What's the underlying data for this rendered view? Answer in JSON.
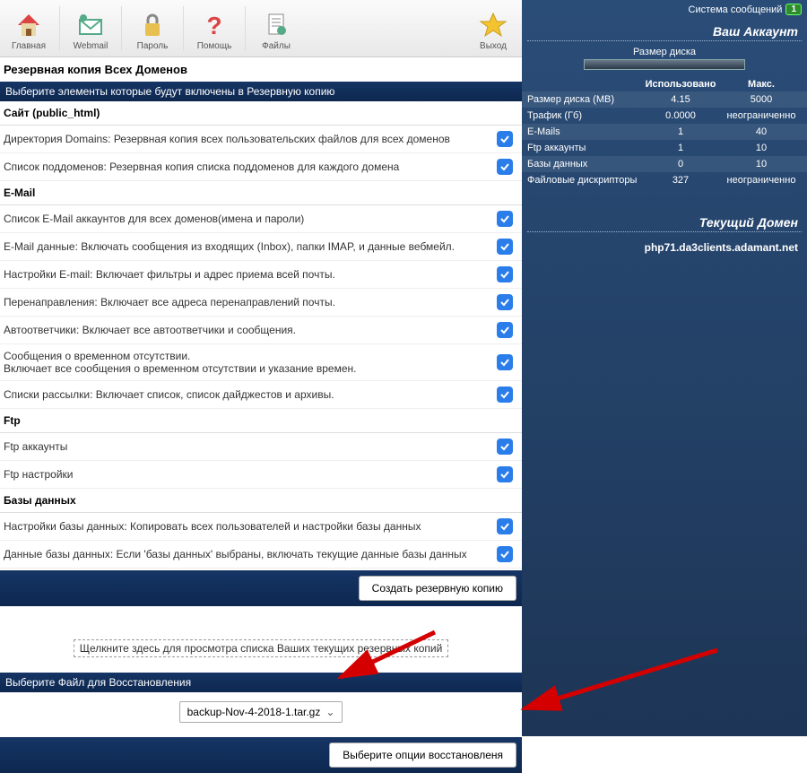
{
  "toolbar": {
    "items": [
      {
        "label": "Главная",
        "icon": "home"
      },
      {
        "label": "Webmail",
        "icon": "mail"
      },
      {
        "label": "Пароль",
        "icon": "lock"
      },
      {
        "label": "Помощь",
        "icon": "help"
      },
      {
        "label": "Файлы",
        "icon": "files"
      }
    ],
    "exit": {
      "label": "Выход",
      "icon": "star"
    }
  },
  "page_title": "Резервная копия Всех Доменов",
  "section_select": "Выберите элементы которые будут включены в Резервную копию",
  "groups": [
    {
      "header": "Сайт (public_html)",
      "rows": [
        {
          "text": "Директория Domains: Резервная копия всех пользовательских файлов для всех доменов"
        },
        {
          "text": "Список поддоменов: Резервная копия списка поддоменов для каждого домена"
        }
      ]
    },
    {
      "header": "E-Mail",
      "rows": [
        {
          "text": "Список E-Mail аккаунтов для всех доменов(имена и пароли)"
        },
        {
          "text": "E-Mail данные: Включать сообщения из входящих (Inbox), папки IMAP, и данные вебмейл."
        },
        {
          "text": "Настройки E-mail: Включает фильтры и адрес приема всей почты."
        },
        {
          "text": "Перенаправления: Включает все адреса перенаправлений почты."
        },
        {
          "text": "Автоответчики: Включает все автоответчики и сообщения."
        },
        {
          "text": "Сообщения о временном отсутствии.\nВключает все сообщения о временном отсутствии и указание времен."
        },
        {
          "text": "Списки рассылки: Включает список, список дайджестов и архивы."
        }
      ]
    },
    {
      "header": "Ftp",
      "rows": [
        {
          "text": "Ftp аккаунты"
        },
        {
          "text": "Ftp настройки"
        }
      ]
    },
    {
      "header": "Базы данных",
      "rows": [
        {
          "text": "Настройки базы данных: Копировать всех пользователей и настройки базы данных"
        },
        {
          "text": "Данные базы данных: Если 'базы данных' выбраны, включать текущие данные базы данных"
        }
      ]
    }
  ],
  "create_button": "Создать резервную копию",
  "view_backups_link": "Щелкните здесь для просмотра списка Ваших текущих резервных копий",
  "restore_header": "Выберите Файл для Восстановления",
  "restore_file": "backup-Nov-4-2018-1.tar.gz",
  "restore_button": "Выберите опции восстановленя",
  "sidebar": {
    "messages_label": "Система сообщений",
    "messages_count": "1",
    "account_title": "Ваш Аккаунт",
    "disk_label": "Размер диска",
    "cols": {
      "used": "Использовано",
      "max": "Макс."
    },
    "stats": [
      {
        "name": "Размер диска (МВ)",
        "used": "4.15",
        "max": "5000"
      },
      {
        "name": "Трафик (Гб)",
        "used": "0.0000",
        "max": "неограниченно"
      },
      {
        "name": "E-Mails",
        "used": "1",
        "max": "40"
      },
      {
        "name": "Ftp аккаунты",
        "used": "1",
        "max": "10"
      },
      {
        "name": "Базы данных",
        "used": "0",
        "max": "10"
      },
      {
        "name": "Файловые дискрипторы",
        "used": "327",
        "max": "неограниченно"
      }
    ],
    "domain_title": "Текущий Домен",
    "domain": "php71.da3clients.adamant.net"
  }
}
